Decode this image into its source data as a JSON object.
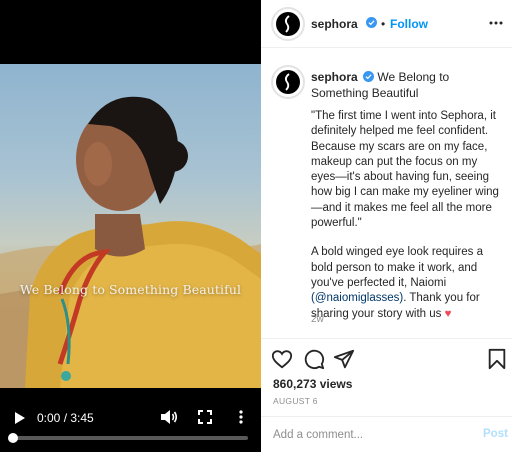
{
  "video": {
    "overlay_text": "We Belong to Something Beautiful",
    "current_time": "0:00",
    "duration": "3:45",
    "time_display": "0:00 / 3:45",
    "progress_fraction": 0.0
  },
  "header": {
    "username": "sephora",
    "separator": "•",
    "follow_label": "Follow"
  },
  "caption": {
    "username": "sephora",
    "title": "We Belong to Something Beautiful",
    "quote": "\"The first time I went into Sephora, it definitely helped me feel confident. Because my scars are on my face, makeup can put the focus on my eyes—it's about having fun, seeing how big I can make my eyeliner wing—and it makes me feel all the more powerful.\"",
    "body_before": "A bold winged eye look requires a bold person to make it work, and you've perfected it, Naiomi ",
    "mention": "(@naiomiglasses)",
    "body_after": ". Thank you for sharing your story with us ",
    "heart": "♥",
    "ago": "2w"
  },
  "stats": {
    "views": "860,273 views",
    "date": "AUGUST 6"
  },
  "comment": {
    "placeholder": "Add a comment...",
    "post_label": "Post"
  },
  "colors": {
    "accent": "#0095f6",
    "post_disabled": "#b2dffc",
    "heart": "#ed4956",
    "verified": "#3897f0"
  },
  "icons": [
    "play-icon",
    "volume-icon",
    "fullscreen-icon",
    "more-vertical-icon",
    "more-horizontal-icon",
    "verified-icon",
    "heart-icon",
    "comment-icon",
    "share-icon",
    "bookmark-icon"
  ]
}
